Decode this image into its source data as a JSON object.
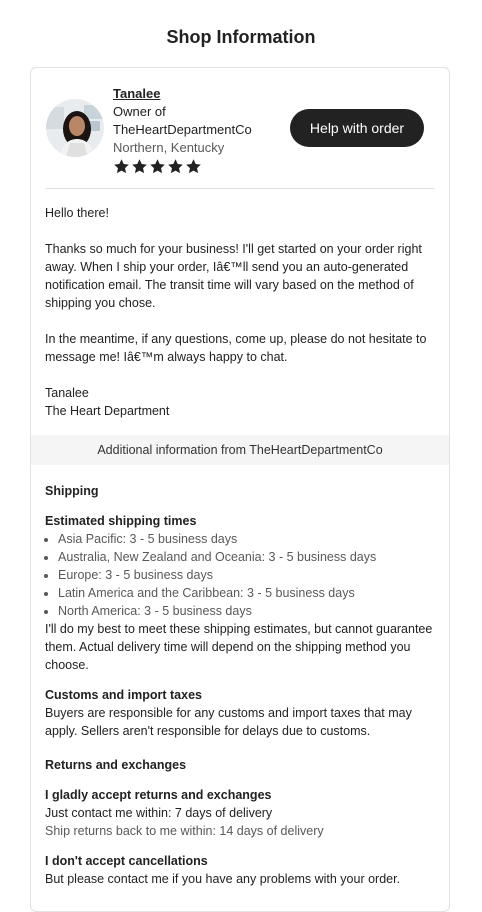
{
  "header": {
    "title": "Shop Information"
  },
  "owner": {
    "name": "Tanalee",
    "role_line1": "Owner of",
    "shop_name": "TheHeartDepartmentCo",
    "location": "Northern, Kentucky",
    "rating": 5,
    "help_button_label": "Help with order"
  },
  "message": {
    "greeting": "Hello there!",
    "para1": "Thanks so much for your business! I'll get started on your order right away. When I ship your order, Iâ€™ll send you an auto-generated notification email. The transit time will vary based on the method of shipping you chose.",
    "para2": "In the meantime, if any questions, come up, please do not hesitate to message me! Iâ€™m always happy to chat.",
    "signature_name": "Tanalee",
    "signature_shop": "The Heart Department"
  },
  "additional_info_label": "Additional information from TheHeartDepartmentCo",
  "shipping": {
    "title": "Shipping",
    "times_title": "Estimated shipping times",
    "times": [
      "Asia Pacific: 3 - 5 business days",
      "Australia, New Zealand and Oceania: 3 - 5 business days",
      "Europe: 3 - 5 business days",
      "Latin America and the Caribbean: 3 - 5 business days",
      "North America: 3 - 5 business days"
    ],
    "note": "I'll do my best to meet these shipping estimates, but cannot guarantee them. Actual delivery time will depend on the shipping method you choose."
  },
  "customs": {
    "title": "Customs and import taxes",
    "text": "Buyers are responsible for any customs and import taxes that may apply. Sellers aren't responsible for delays due to customs."
  },
  "returns": {
    "title": "Returns and exchanges",
    "accept_title": "I gladly accept returns and exchanges",
    "contact_within": "Just contact me within: 7 days of delivery",
    "ship_back_within": "Ship returns back to me within: 14 days of delivery",
    "cancel_title": "I don't accept cancellations",
    "cancel_text": "But please contact me if you have any problems with your order."
  },
  "colors": {
    "text": "#222222",
    "muted": "#595959",
    "button_bg": "#222222",
    "panel_bg": "#f5f5f5"
  },
  "icons": {
    "star": "star-icon"
  }
}
